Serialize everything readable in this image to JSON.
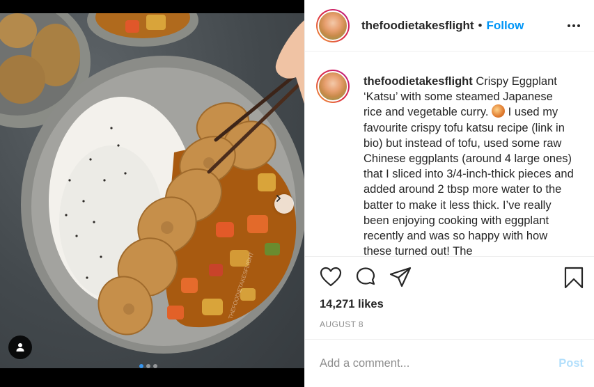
{
  "post": {
    "username": "thefoodietakesflight",
    "follow_label": "Follow",
    "separator": "•",
    "caption": {
      "username": "thefoodietakesflight",
      "text_before_emoji": "Crispy Eggplant ‘Katsu’ with some steamed Japanese rice and vegetable curry.",
      "text_after_emoji": "I used my favourite crispy tofu katsu recipe (link in bio) but instead of tofu, used some raw Chinese eggplants (around 4 large ones) that I sliced into 3/4-inch-thick pieces and added around 2 tbsp more water to the batter to make it less thick. I’ve really been enjoying cooking with eggplant recently and was so happy with how these turned out! The"
    },
    "likes": "14,271 likes",
    "date": "AUGUST 8",
    "comment": {
      "placeholder": "Add a comment...",
      "post_label": "Post"
    },
    "watermark": "THEFOODIETAKESFLIGHT",
    "carousel": {
      "count": 3,
      "active_index": 0
    }
  },
  "icons": {
    "like": "heart-icon",
    "comment": "comment-icon",
    "share": "paper-plane-icon",
    "save": "bookmark-icon",
    "more": "more-options-icon",
    "next": "chevron-right-icon",
    "tag": "user-tag-icon"
  },
  "colors": {
    "follow": "#0095f6",
    "post_disabled": "#b2dffc",
    "carousel_active": "#3897f0"
  }
}
